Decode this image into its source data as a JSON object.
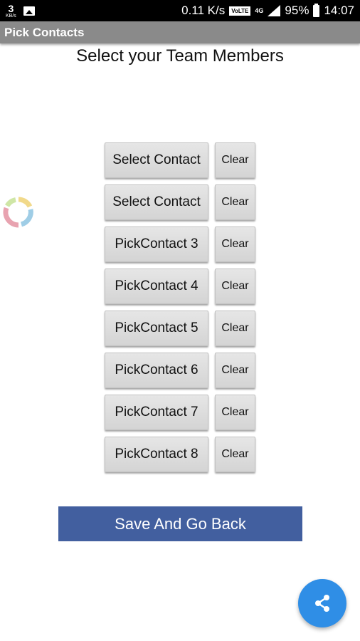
{
  "status_bar": {
    "net_speed_value": "3",
    "net_speed_unit": "KB/s",
    "data_rate": "0.11 K/s",
    "volte": "VoLTE",
    "network": "4G",
    "battery": "95%",
    "time": "14:07"
  },
  "app": {
    "title": "Pick Contacts"
  },
  "main": {
    "heading": "Select your Team Members",
    "rows": [
      {
        "pick_label": "Select Contact",
        "clear_label": "Clear"
      },
      {
        "pick_label": "Select Contact",
        "clear_label": "Clear"
      },
      {
        "pick_label": "PickContact 3",
        "clear_label": "Clear"
      },
      {
        "pick_label": "PickContact 4",
        "clear_label": "Clear"
      },
      {
        "pick_label": "PickContact 5",
        "clear_label": "Clear"
      },
      {
        "pick_label": "PickContact 6",
        "clear_label": "Clear"
      },
      {
        "pick_label": "PickContact 7",
        "clear_label": "Clear"
      },
      {
        "pick_label": "PickContact 8",
        "clear_label": "Clear"
      }
    ],
    "save_label": "Save And Go Back"
  },
  "colors": {
    "title_bar": "#8a8a8a",
    "save_button": "#425f9f",
    "fab": "#2f8ee6"
  },
  "icons": {
    "fab": "share-icon",
    "loader": "loading-spinner-icon"
  }
}
